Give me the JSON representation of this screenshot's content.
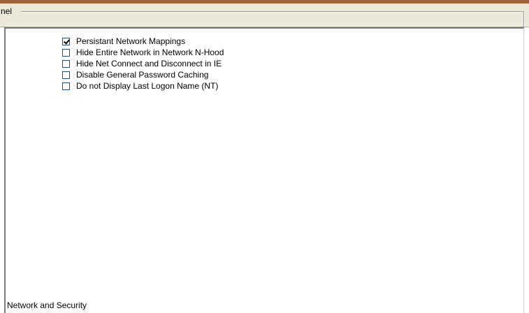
{
  "panel": {
    "caption": "nel",
    "section_label": "Network and Security"
  },
  "options": [
    {
      "label": "Persistant Network Mappings",
      "checked": true
    },
    {
      "label": "Hide Entire Network in Network N-Hood",
      "checked": false
    },
    {
      "label": "Hide Net Connect and Disconnect in IE",
      "checked": false
    },
    {
      "label": "Disable General Password Caching",
      "checked": false
    },
    {
      "label": "Do not Display Last Logon Name (NT)",
      "checked": false
    }
  ],
  "colors": {
    "top_accent": "#a0643c",
    "header_background": "#ece9d8",
    "panel_background": "#ffffff"
  }
}
